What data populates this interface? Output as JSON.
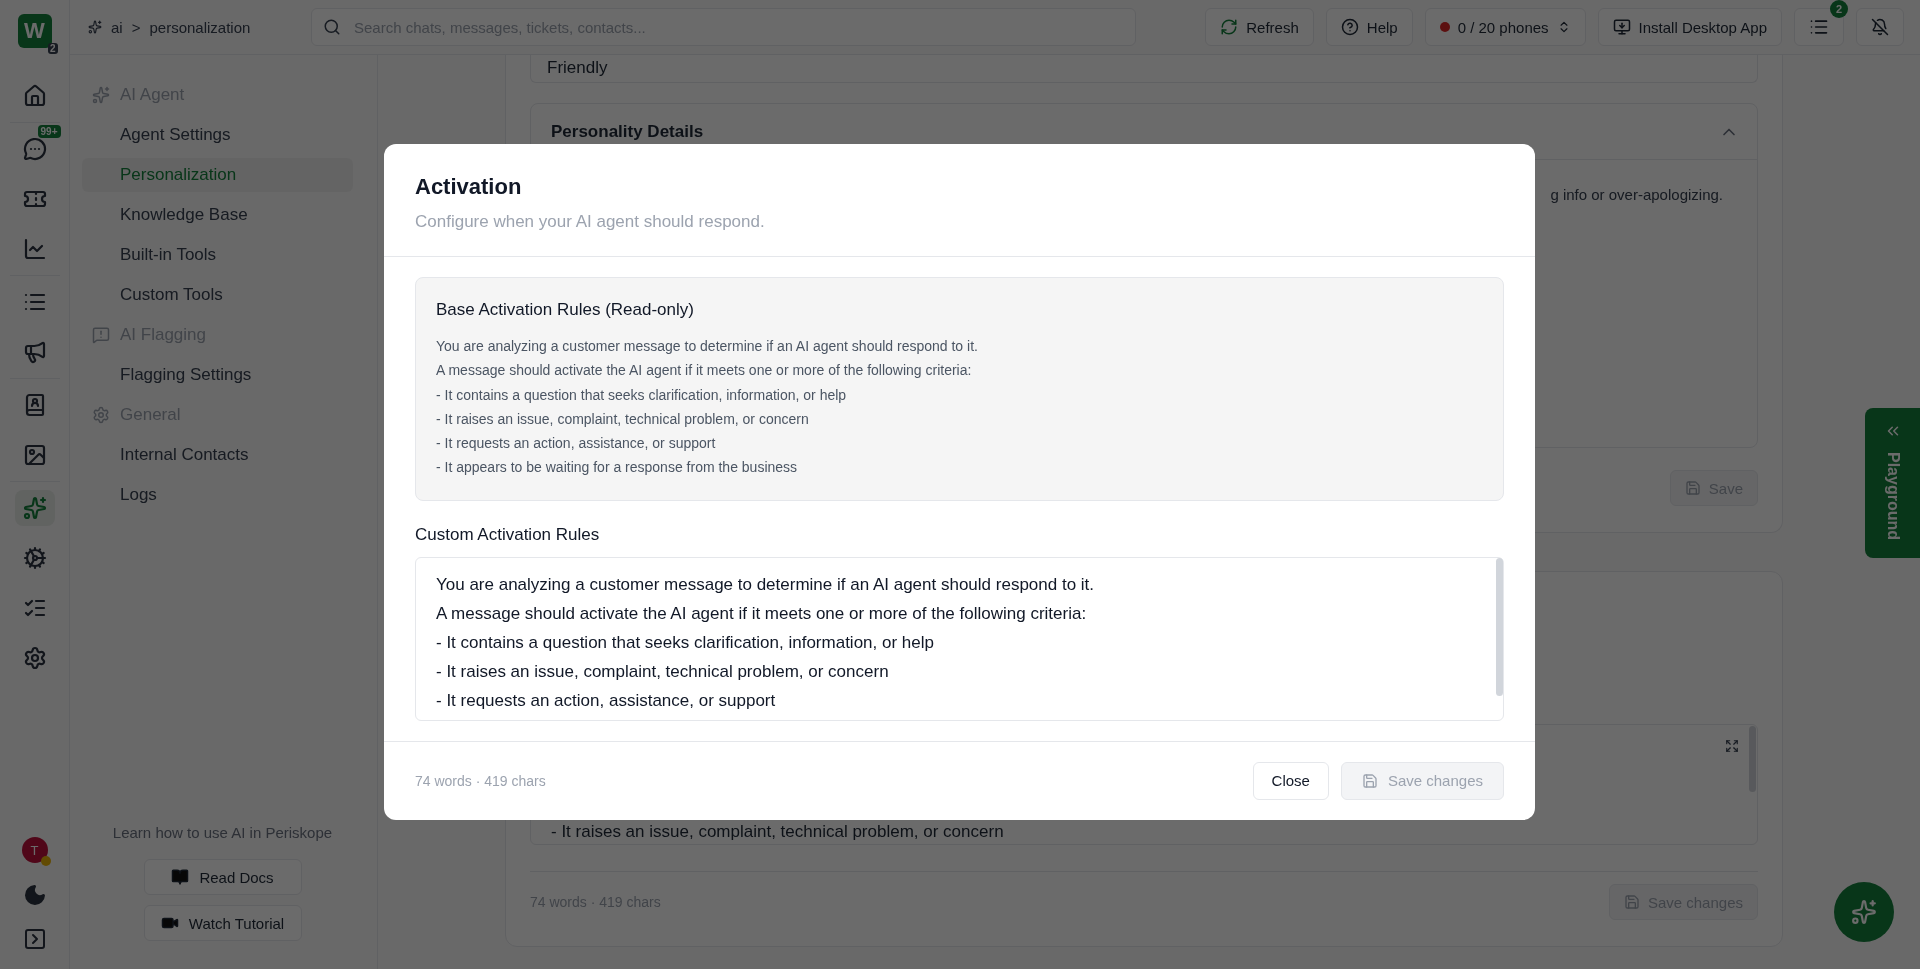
{
  "topbar": {
    "logo": "W",
    "logo_badge": "2",
    "breadcrumb": [
      "ai",
      "personalization"
    ],
    "breadcrumb_separator": ">",
    "search": {
      "placeholder": "Search chats, messages, tickets, contacts..."
    },
    "buttons": [
      {
        "kind": "refresh",
        "label": "Refresh"
      },
      {
        "kind": "help",
        "label": "Help"
      },
      {
        "kind": "phones",
        "label": "0 / 20 phones"
      },
      {
        "kind": "install",
        "label": "Install Desktop App"
      }
    ],
    "tasks_badge": "2"
  },
  "rail": {
    "groups": [
      [
        {
          "kind": "home",
          "selected": false
        }
      ],
      [
        {
          "kind": "chats",
          "selected": false,
          "badge": "99+"
        },
        {
          "kind": "tickets",
          "selected": false
        },
        {
          "kind": "analytics",
          "selected": false
        }
      ],
      [
        {
          "kind": "lists",
          "selected": false
        },
        {
          "kind": "broadcast",
          "selected": false
        }
      ],
      [
        {
          "kind": "contacts",
          "selected": false
        },
        {
          "kind": "media",
          "selected": false
        }
      ],
      [
        {
          "kind": "ai",
          "selected": true
        },
        {
          "kind": "integrations",
          "selected": false
        },
        {
          "kind": "tasks",
          "selected": false
        },
        {
          "kind": "settings",
          "selected": false
        }
      ]
    ],
    "avatar": "T"
  },
  "sidebar": {
    "sections": [
      {
        "kind": "ai",
        "title": "AI Agent",
        "items": [
          {
            "label": "Agent Settings",
            "selected": false
          },
          {
            "label": "Personalization",
            "selected": true
          },
          {
            "label": "Knowledge Base",
            "selected": false
          },
          {
            "label": "Built-in Tools",
            "selected": false
          },
          {
            "label": "Custom Tools",
            "selected": false
          }
        ]
      },
      {
        "kind": "flag",
        "title": "AI Flagging",
        "items": [
          {
            "label": "Flagging Settings",
            "selected": false
          }
        ]
      },
      {
        "kind": "general",
        "title": "General",
        "items": [
          {
            "label": "Internal Contacts",
            "selected": false
          },
          {
            "label": "Logs",
            "selected": false
          }
        ]
      }
    ],
    "footer_text": "Learn how to use AI in Periskope",
    "footer_buttons": [
      {
        "kind": "docs",
        "label": "Read Docs"
      },
      {
        "kind": "video",
        "label": "Watch Tutorial"
      }
    ]
  },
  "background": {
    "tone_select": "Friendly",
    "personality": {
      "title": "Personality Details",
      "expanded": true,
      "text": "g info or over-apologizing.",
      "save": "Save"
    },
    "activation_card": {
      "text": "- It raises an issue, complaint, technical problem, or concern",
      "count": "74 words · 419 chars",
      "save": "Save changes"
    },
    "playground": "Playground"
  },
  "modal": {
    "title": "Activation",
    "subtitle": "Configure when your AI agent should respond.",
    "base_title": "Base Activation Rules (Read-only)",
    "base_text": "You are analyzing a customer message to determine if an AI agent should respond to it.\nA message should activate the AI agent if it meets one or more of the following criteria:\n- It contains a question that seeks clarification, information, or help\n- It raises an issue, complaint, technical problem, or concern\n- It requests an action, assistance, or support\n- It appears to be waiting for a response from the business",
    "custom_label": "Custom Activation Rules",
    "custom_text": "You are analyzing a customer message to determine if an AI agent should respond to it.\nA message should activate the AI agent if it meets one or more of the following criteria:\n- It contains a question that seeks clarification, information, or help\n- It raises an issue, complaint, technical problem, or concern\n- It requests an action, assistance, or support",
    "count": "74 words · 419 chars",
    "close": "Close",
    "save": "Save changes",
    "save_disabled": true
  }
}
